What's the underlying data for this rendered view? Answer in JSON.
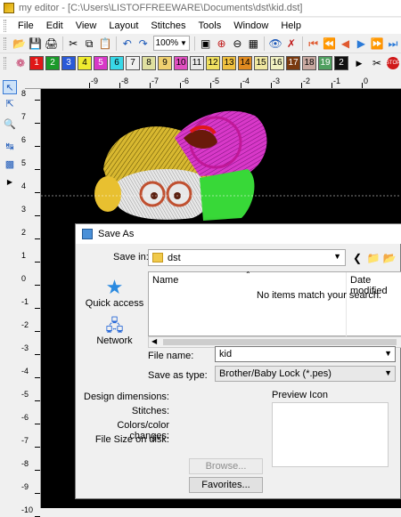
{
  "window": {
    "title": "my editor - [C:\\Users\\LISTOFFREEWARE\\Documents\\dst\\kid.dst]"
  },
  "menu": [
    "File",
    "Edit",
    "View",
    "Layout",
    "Stitches",
    "Tools",
    "Window",
    "Help"
  ],
  "toolbar": {
    "zoom": "100%"
  },
  "palette": [
    {
      "num": "1",
      "color": "#e01818"
    },
    {
      "num": "2",
      "color": "#1a9a2a"
    },
    {
      "num": "3",
      "color": "#2a5ad8"
    },
    {
      "num": "4",
      "color": "#f0ec30"
    },
    {
      "num": "5",
      "color": "#d838c8"
    },
    {
      "num": "6",
      "color": "#38d8e8"
    },
    {
      "num": "7",
      "color": "#f0f0f0"
    },
    {
      "num": "8",
      "color": "#e0e0a0"
    },
    {
      "num": "9",
      "color": "#f0d070"
    },
    {
      "num": "10",
      "color": "#e050c0"
    },
    {
      "num": "11",
      "color": "#e8e8e8"
    },
    {
      "num": "12",
      "color": "#f0e060"
    },
    {
      "num": "13",
      "color": "#f0c040"
    },
    {
      "num": "14",
      "color": "#e08a20"
    },
    {
      "num": "15",
      "color": "#f0e8a0"
    },
    {
      "num": "16",
      "color": "#f0f0c0"
    },
    {
      "num": "17",
      "color": "#7a3a10"
    },
    {
      "num": "18",
      "color": "#c8a8a0"
    },
    {
      "num": "19",
      "color": "#50a060"
    },
    {
      "num": "2",
      "color": "#101010"
    }
  ],
  "ruler": {
    "unit": "cm",
    "top": [
      "-9",
      "-8",
      "-7",
      "-6",
      "-5",
      "-4",
      "-3",
      "-2",
      "-1",
      "0"
    ],
    "left": [
      "8",
      "7",
      "6",
      "5",
      "4",
      "3",
      "2",
      "1",
      "0",
      "-1",
      "-2",
      "-3",
      "-4",
      "-5",
      "-6",
      "-7",
      "-8",
      "-9",
      "-10"
    ]
  },
  "dialog": {
    "title": "Save As",
    "save_in_label": "Save in:",
    "save_in_value": "dst",
    "places": [
      "Quick access",
      "Network"
    ],
    "columns": [
      "Name",
      "Date modified"
    ],
    "empty_message": "No items match your search.",
    "file_name_label": "File name:",
    "file_name_value": "kid",
    "type_label": "Save as type:",
    "type_value": "Brother/Baby Lock (*.pes)",
    "info_labels": [
      "Design dimensions:",
      "Stitches:",
      "Colors/color changes:",
      "File Size on disk:"
    ],
    "preview_label": "Preview Icon",
    "browse_label": "Browse...",
    "favorites_label": "Favorites..."
  }
}
